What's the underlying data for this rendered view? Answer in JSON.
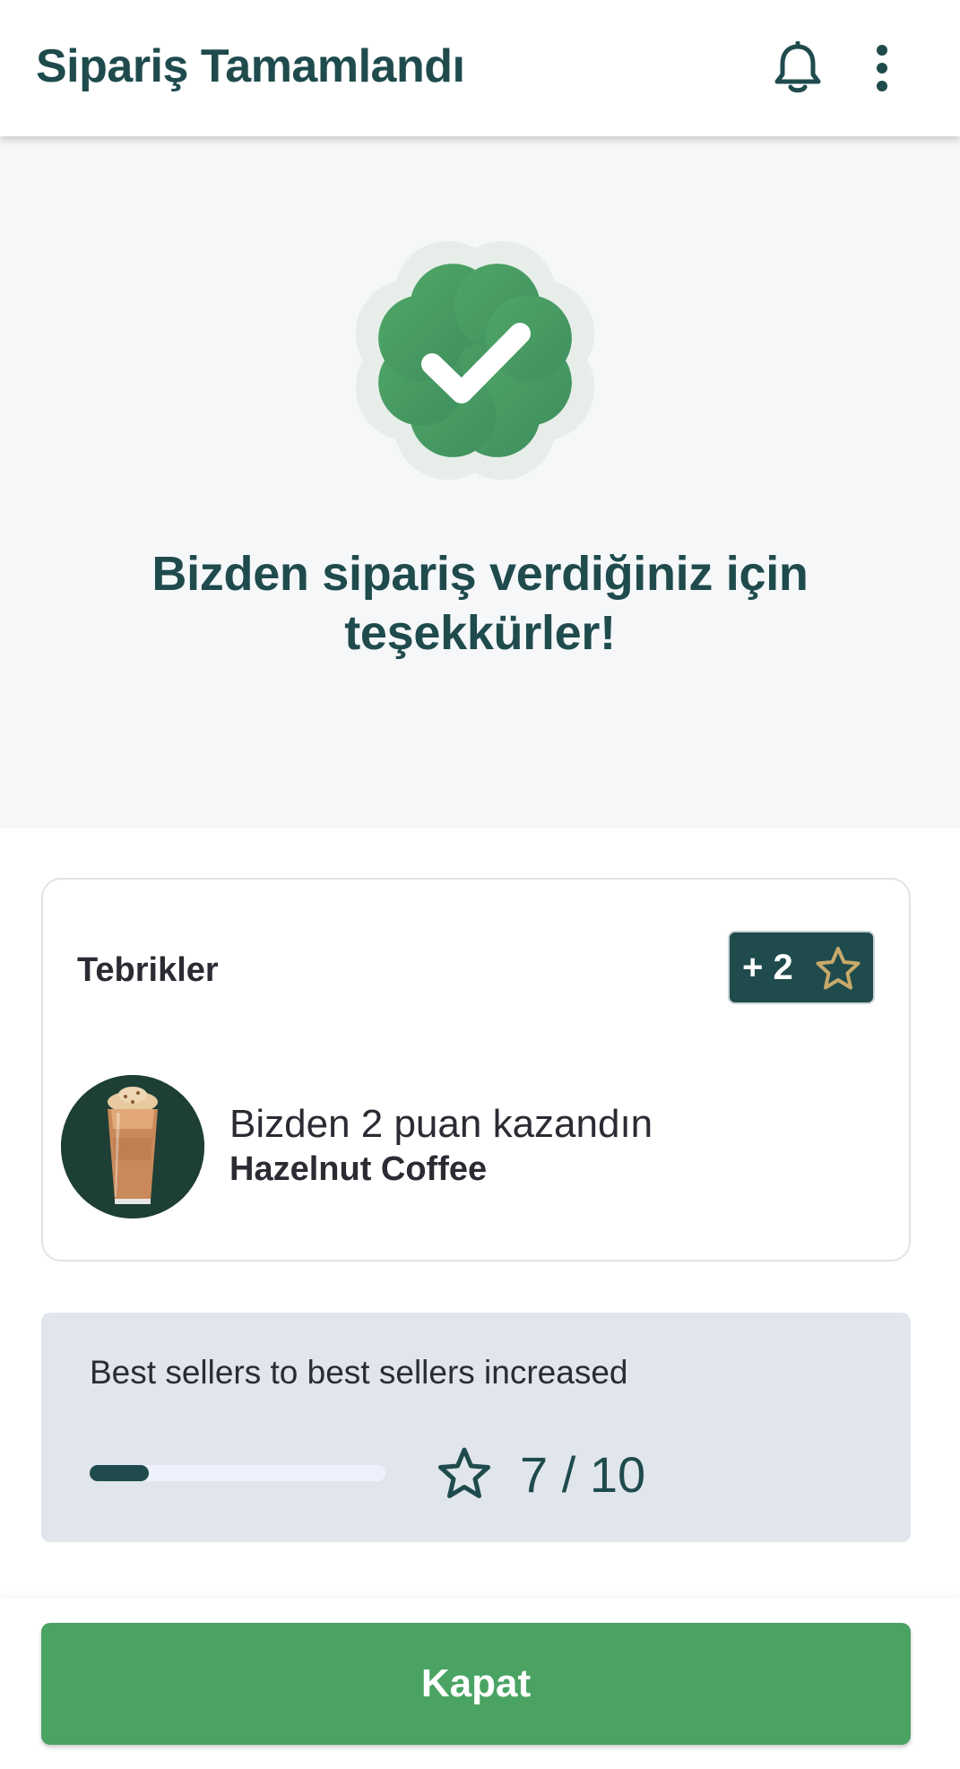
{
  "header": {
    "title": "Sipariş Tamamlandı",
    "bell_icon": "bell-icon",
    "more_icon": "more-vertical-icon"
  },
  "hero": {
    "badge_icon": "verified-check-badge-icon",
    "thanks_message": "Bizden sipariş verdiğiniz için teşekkürler!"
  },
  "congrats_card": {
    "title": "Tebrikler",
    "points_badge": "+ 2",
    "points_icon": "star-icon",
    "earn_text": "Bizden 2 puan kazandın",
    "product_name": "Hazelnut Coffee",
    "product_image": "iced-coffee-drink-image"
  },
  "progress": {
    "label": "Best sellers to best sellers increased",
    "current": 7,
    "total": 10,
    "count_text": "7 / 10",
    "bar_fraction": 0.2,
    "icon": "star-outline-icon"
  },
  "footer": {
    "close_label": "Kapat"
  },
  "colors": {
    "primary_dark": "#1f4b4d",
    "success_green": "#4aa363",
    "star_gold": "#c8a96a",
    "hero_bg": "#f5f7f9",
    "progress_card_bg": "#e1e5ec"
  }
}
